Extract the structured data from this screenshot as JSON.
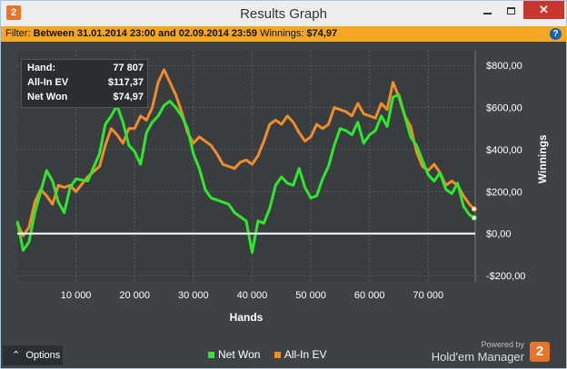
{
  "window": {
    "title": "Results Graph",
    "app_badge": "2",
    "minimize_icon": "minimize-icon",
    "maximize_icon": "maximize-icon",
    "close_label": "✕"
  },
  "filter": {
    "label": "Filter:",
    "text": "Between 31.01.2014 23:00 and 02.09.2014 23:59",
    "winnings_label": "Winnings:",
    "winnings_value": "$74,97",
    "help": "?"
  },
  "tooltip": {
    "rows": [
      {
        "label": "Hand:",
        "value": "77 807"
      },
      {
        "label": "All-In EV",
        "value": "$117,37"
      },
      {
        "label": "Net Won",
        "value": "$74,97"
      }
    ]
  },
  "bottom": {
    "options_label": "Options",
    "powered_by": "Powered by",
    "brand": "Hold'em Manager",
    "brand_logo": "2"
  },
  "colors": {
    "net_won": "#2ee82e",
    "all_in_ev": "#f08c2a",
    "zero_line": "#ffffff",
    "grid": "#55595d"
  },
  "chart_data": {
    "type": "line",
    "xlabel": "Hands",
    "ylabel": "Winnings",
    "x_ticks": [
      "10 000",
      "20 000",
      "30 000",
      "40 000",
      "50 000",
      "60 000",
      "70 000"
    ],
    "x_tick_values": [
      10000,
      20000,
      30000,
      40000,
      50000,
      60000,
      70000
    ],
    "y_ticks": [
      "$800,00",
      "$600,00",
      "$400,00",
      "$200,00",
      "$0,00",
      "-$200,00"
    ],
    "y_tick_values": [
      800,
      600,
      400,
      200,
      0,
      -200
    ],
    "xlim": [
      0,
      78000
    ],
    "ylim": [
      -230,
      870
    ],
    "y_axis_side": "right",
    "grid": true,
    "legend_position": "bottom",
    "series": [
      {
        "name": "Net Won",
        "x": [
          0,
          1000,
          2000,
          3000,
          4000,
          5000,
          6000,
          7000,
          8000,
          9000,
          10000,
          12000,
          14000,
          15000,
          16000,
          17000,
          18000,
          19000,
          20000,
          21000,
          22000,
          23000,
          24000,
          25000,
          26000,
          27000,
          28000,
          29000,
          30000,
          31000,
          32000,
          33000,
          34000,
          35000,
          36000,
          37000,
          38000,
          39000,
          40000,
          41000,
          42000,
          43000,
          44000,
          45000,
          46000,
          47000,
          48000,
          49000,
          50000,
          51000,
          52000,
          53000,
          54000,
          55000,
          56000,
          57000,
          58000,
          59000,
          60000,
          61000,
          62000,
          63000,
          64000,
          65000,
          66000,
          67000,
          68000,
          69000,
          70000,
          71000,
          72000,
          73000,
          74000,
          75000,
          76000,
          77000,
          77807
        ],
        "values": [
          60,
          -80,
          -40,
          100,
          200,
          300,
          250,
          150,
          100,
          220,
          260,
          250,
          380,
          520,
          560,
          610,
          530,
          420,
          390,
          330,
          480,
          530,
          560,
          610,
          630,
          600,
          560,
          500,
          380,
          310,
          210,
          170,
          160,
          150,
          140,
          100,
          80,
          60,
          -90,
          60,
          50,
          120,
          230,
          270,
          240,
          230,
          310,
          220,
          170,
          180,
          260,
          320,
          420,
          500,
          490,
          470,
          530,
          430,
          470,
          490,
          560,
          510,
          650,
          660,
          560,
          460,
          420,
          350,
          280,
          250,
          290,
          210,
          190,
          240,
          130,
          90,
          74.97
        ]
      },
      {
        "name": "All-In EV",
        "x": [
          0,
          1000,
          2000,
          3000,
          4000,
          5000,
          6000,
          7000,
          8000,
          9000,
          10000,
          12000,
          14000,
          15000,
          16000,
          17000,
          18000,
          19000,
          20000,
          21000,
          22000,
          23000,
          24000,
          25000,
          26000,
          27000,
          28000,
          29000,
          30000,
          31000,
          32000,
          33000,
          34000,
          35000,
          36000,
          37000,
          38000,
          39000,
          40000,
          41000,
          42000,
          43000,
          44000,
          45000,
          46000,
          47000,
          48000,
          49000,
          50000,
          51000,
          52000,
          53000,
          54000,
          55000,
          56000,
          57000,
          58000,
          59000,
          60000,
          61000,
          62000,
          63000,
          64000,
          65000,
          66000,
          67000,
          68000,
          69000,
          70000,
          71000,
          72000,
          73000,
          74000,
          75000,
          76000,
          77000,
          77807
        ],
        "values": [
          50,
          -10,
          30,
          150,
          210,
          180,
          140,
          230,
          220,
          230,
          200,
          270,
          320,
          420,
          500,
          470,
          430,
          500,
          500,
          560,
          540,
          600,
          720,
          780,
          720,
          660,
          580,
          480,
          430,
          460,
          440,
          420,
          380,
          330,
          320,
          310,
          340,
          350,
          330,
          370,
          440,
          520,
          540,
          520,
          560,
          530,
          480,
          440,
          460,
          520,
          500,
          520,
          600,
          590,
          580,
          560,
          620,
          570,
          560,
          550,
          620,
          590,
          720,
          650,
          560,
          510,
          390,
          320,
          300,
          330,
          290,
          230,
          250,
          230,
          180,
          140,
          117.37
        ]
      }
    ]
  }
}
